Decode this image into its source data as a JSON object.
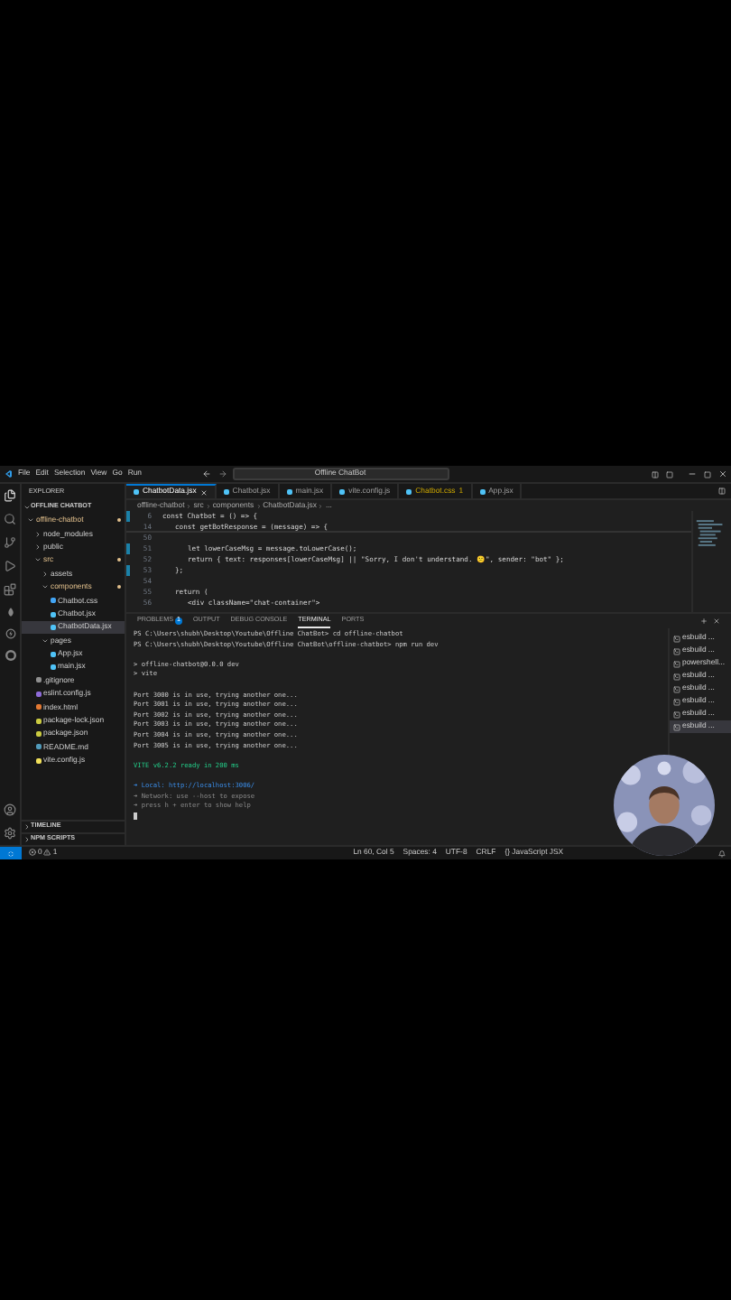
{
  "title_bar": {
    "menus": [
      "File",
      "Edit",
      "Selection",
      "View",
      "Go",
      "Run"
    ],
    "search": "Offline ChatBot"
  },
  "explorer": {
    "title": "EXPLORER",
    "folder": "OFFLINE CHATBOT",
    "tree": [
      {
        "label": "offline-chatbot",
        "kind": "folder",
        "expanded": true,
        "selected": false,
        "modified": true,
        "children": [
          {
            "label": "node_modules",
            "kind": "folder",
            "expanded": false,
            "selected": false,
            "modified": false
          },
          {
            "label": "public",
            "kind": "folder",
            "expanded": false,
            "selected": false,
            "modified": false
          },
          {
            "label": "src",
            "kind": "folder",
            "expanded": true,
            "selected": false,
            "modified": true,
            "children": [
              {
                "label": "assets",
                "kind": "folder",
                "expanded": false,
                "selected": false,
                "modified": false
              },
              {
                "label": "components",
                "kind": "folder",
                "expanded": true,
                "selected": false,
                "modified": true,
                "children": [
                  {
                    "label": "Chatbot.css",
                    "kind": "css",
                    "selected": false,
                    "modified": false
                  },
                  {
                    "label": "Chatbot.jsx",
                    "kind": "jsx",
                    "selected": false,
                    "modified": false
                  },
                  {
                    "label": "ChatbotData.jsx",
                    "kind": "jsx",
                    "selected": true,
                    "modified": false
                  }
                ]
              },
              {
                "label": "pages",
                "kind": "folder",
                "expanded": true,
                "selected": false,
                "modified": false,
                "children": [
                  {
                    "label": "App.jsx",
                    "kind": "jsx",
                    "selected": false,
                    "modified": false
                  },
                  {
                    "label": "main.jsx",
                    "kind": "jsx",
                    "selected": false,
                    "modified": false
                  }
                ]
              }
            ]
          },
          {
            "label": ".gitignore",
            "kind": "git",
            "selected": false,
            "modified": false
          },
          {
            "label": "eslint.config.js",
            "kind": "eslint",
            "selected": false,
            "modified": false
          },
          {
            "label": "index.html",
            "kind": "html",
            "selected": false,
            "modified": false
          },
          {
            "label": "package-lock.json",
            "kind": "json",
            "selected": false,
            "modified": false
          },
          {
            "label": "package.json",
            "kind": "json",
            "selected": false,
            "modified": false
          },
          {
            "label": "README.md",
            "kind": "md",
            "selected": false,
            "modified": false
          },
          {
            "label": "vite.config.js",
            "kind": "js",
            "selected": false,
            "modified": false
          }
        ]
      }
    ],
    "sections": [
      "TIMELINE",
      "NPM SCRIPTS"
    ]
  },
  "editor_tabs": [
    {
      "label": "ChatbotData.jsx",
      "selected": true
    },
    {
      "label": "Chatbot.jsx",
      "selected": false
    },
    {
      "label": "main.jsx",
      "selected": false
    },
    {
      "label": "vite.config.js",
      "selected": false
    },
    {
      "label": "Chatbot.css",
      "selected": false,
      "badge": "1"
    },
    {
      "label": "App.jsx",
      "selected": false
    }
  ],
  "breadcrumb": [
    "offline-chatbot",
    "src",
    "components",
    "ChatbotData.jsx",
    "..."
  ],
  "code": [
    {
      "number": "6",
      "text": "const Chatbot = () => {",
      "modified": true,
      "children": [
        {
          "number": "14",
          "text": "const getBotResponse = (message) => {",
          "modified": false,
          "children": [
            {
              "number": "50",
              "modified": false
            },
            {
              "number": "51",
              "text": "let lowerCaseMsg = message.toLowerCase();",
              "modified": true
            },
            {
              "number": "52",
              "text": "return { text: responses[lowerCaseMsg] || \"Sorry, I don't understand. 😕\", sender: \"bot\" };",
              "modified": false
            }
          ]
        },
        {
          "number": "53",
          "text": "};",
          "modified": true
        },
        {
          "number": "54",
          "modified": false
        },
        {
          "number": "55",
          "text": "return (",
          "modified": false,
          "children": [
            {
              "number": "56",
              "text": "<div className=\"chat-container\">",
              "modified": false
            }
          ]
        }
      ]
    }
  ],
  "panel_tabs": [
    {
      "label": "PROBLEMS",
      "selected": false,
      "badge": "1"
    },
    {
      "label": "OUTPUT",
      "selected": false
    },
    {
      "label": "DEBUG CONSOLE",
      "selected": false
    },
    {
      "label": "TERMINAL",
      "selected": true
    },
    {
      "label": "PORTS",
      "selected": false
    }
  ],
  "terminal": [
    {
      "kind": "prompt",
      "text": "PS C:\\Users\\shubh\\Desktop\\Youtube\\Offline ChatBot> cd offline-chatbot"
    },
    {
      "kind": "prompt",
      "text": "PS C:\\Users\\shubh\\Desktop\\Youtube\\Offline ChatBot\\offline-chatbot> npm run dev"
    },
    {
      "kind": "blank"
    },
    {
      "kind": "plain",
      "text": "> offline-chatbot@0.0.0 dev"
    },
    {
      "kind": "plain",
      "text": "> vite"
    },
    {
      "kind": "blank"
    },
    {
      "kind": "plain",
      "text": "Port 3000 is in use, trying another one..."
    },
    {
      "kind": "plain",
      "text": "Port 3001 is in use, trying another one..."
    },
    {
      "kind": "plain",
      "text": "Port 3002 is in use, trying another one..."
    },
    {
      "kind": "plain",
      "text": "Port 3003 is in use, trying another one..."
    },
    {
      "kind": "plain",
      "text": "Port 3004 is in use, trying another one..."
    },
    {
      "kind": "plain",
      "text": "Port 3005 is in use, trying another one..."
    },
    {
      "kind": "blank"
    },
    {
      "kind": "vite",
      "text": "VITE v6.2.2  ready in 200 ms"
    },
    {
      "kind": "blank"
    },
    {
      "kind": "link",
      "text": "➜  Local:   http://localhost:3006/"
    },
    {
      "kind": "dim",
      "text": "➜  Network: use --host to expose"
    },
    {
      "kind": "dim",
      "text": "➜  press h + enter to show help"
    },
    {
      "kind": "cursor"
    }
  ],
  "terminal_list": [
    {
      "label": "esbuild ...",
      "selected": false
    },
    {
      "label": "esbuild ...",
      "selected": false
    },
    {
      "label": "powershell...",
      "selected": false
    },
    {
      "label": "esbuild ...",
      "selected": false
    },
    {
      "label": "esbuild ...",
      "selected": false
    },
    {
      "label": "esbuild ...",
      "selected": false
    },
    {
      "label": "esbuild ...",
      "selected": false
    },
    {
      "label": "esbuild ...",
      "selected": true
    }
  ],
  "status_bar": {
    "errors": "0",
    "warnings": "1",
    "items": [
      "Ln 60, Col 5",
      "Spaces: 4",
      "UTF-8",
      "CRLF",
      "{} JavaScript JSX"
    ]
  }
}
